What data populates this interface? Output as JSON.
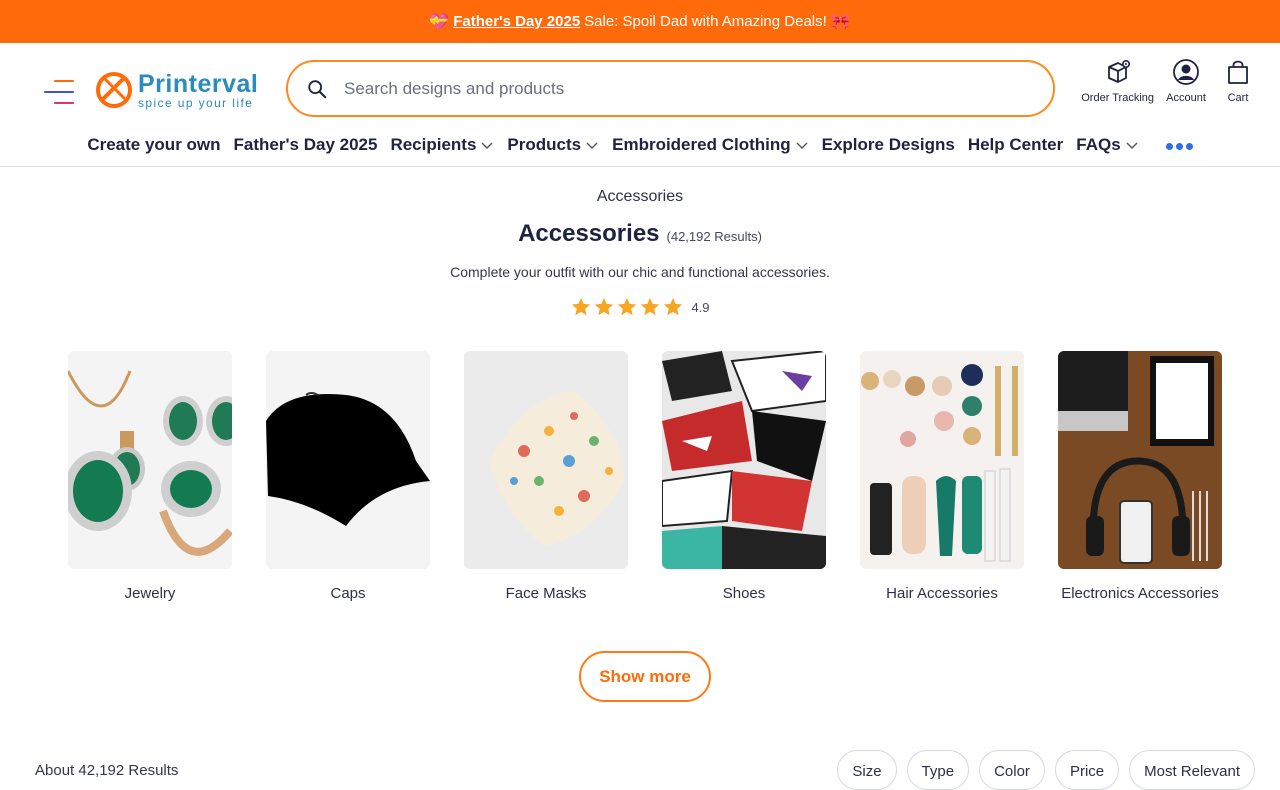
{
  "promo": {
    "text_link": "Father's Day 2025",
    "text_rest": "Sale: Spoil Dad with Amazing Deals!",
    "left_emoji": "💝",
    "right_emoji": "🎀"
  },
  "header": {
    "logo_name": "Printerval",
    "logo_tagline": "spice up your life",
    "search_placeholder": "Search designs and products",
    "actions": [
      {
        "label": "Order Tracking",
        "icon": "package-location-icon"
      },
      {
        "label": "Account",
        "icon": "user-circle-icon"
      },
      {
        "label": "Cart",
        "icon": "shopping-bag-icon"
      }
    ]
  },
  "nav": {
    "items": [
      {
        "label": "Create your own",
        "dropdown": false
      },
      {
        "label": "Father's Day 2025",
        "dropdown": false
      },
      {
        "label": "Recipients",
        "dropdown": true
      },
      {
        "label": "Products",
        "dropdown": true
      },
      {
        "label": "Embroidered Clothing",
        "dropdown": true
      },
      {
        "label": "Explore Designs",
        "dropdown": false
      },
      {
        "label": "Help Center",
        "dropdown": false
      },
      {
        "label": "FAQs",
        "dropdown": true
      }
    ],
    "more_icon": "more-dots-icon"
  },
  "page": {
    "breadcrumb": "Accessories",
    "title": "Accessories",
    "result_count": "(42,192 Results)",
    "description": "Complete your outfit with our chic and functional accessories.",
    "rating": "4.9",
    "rating_stars": 5
  },
  "categories": [
    {
      "name": "Jewelry"
    },
    {
      "name": "Caps"
    },
    {
      "name": "Face Masks"
    },
    {
      "name": "Shoes"
    },
    {
      "name": "Hair Accessories"
    },
    {
      "name": "Electronics Accessories"
    }
  ],
  "show_more": "Show more",
  "results": {
    "count_text": "About 42,192 Results",
    "filters": [
      "Size",
      "Type",
      "Color",
      "Price",
      "Most Relevant"
    ]
  },
  "colors": {
    "accent": "#ff6b0a",
    "brand_blue": "#2a8bbf",
    "star": "#f5a623",
    "text": "#1f2240"
  }
}
